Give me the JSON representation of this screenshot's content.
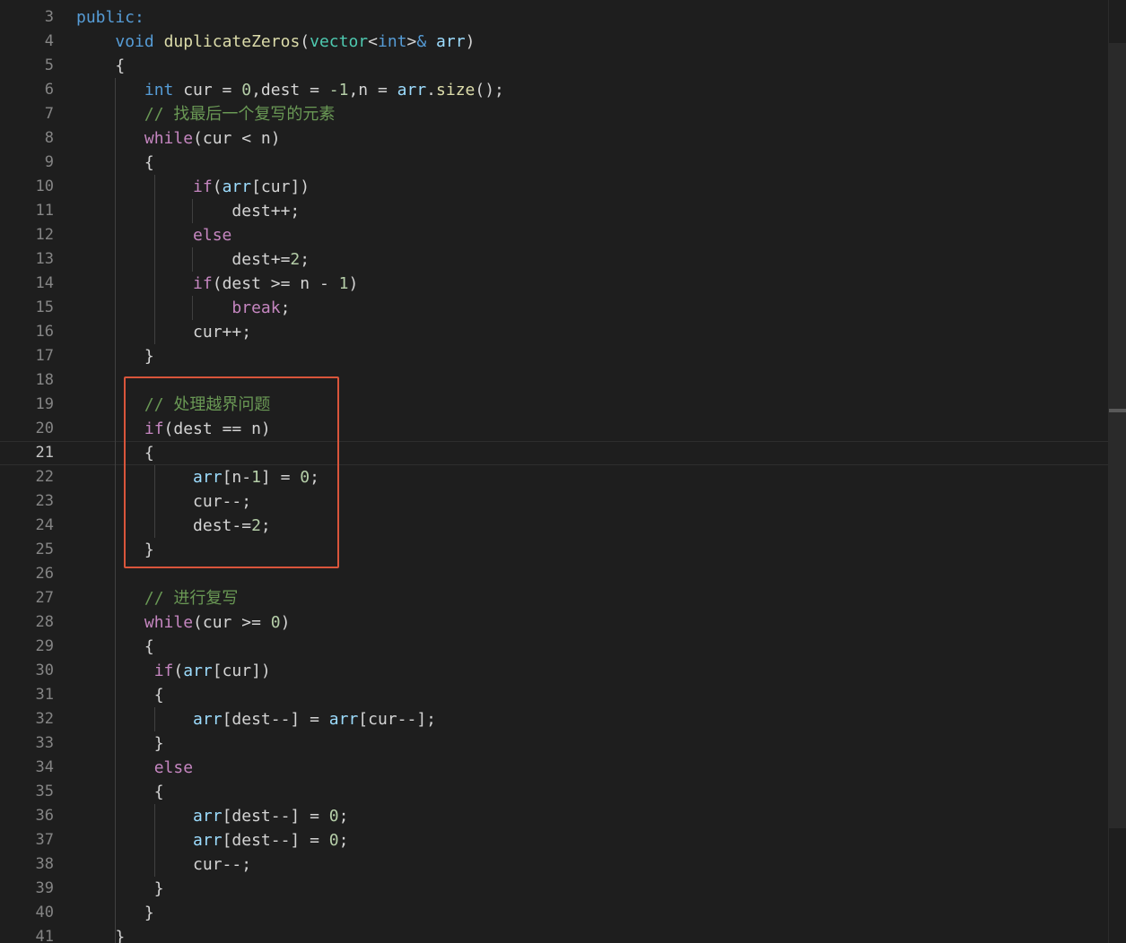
{
  "editor": {
    "active_line": 21,
    "theme": {
      "background": "#1e1e1e",
      "keyword_blue": "#569cd6",
      "control_purple": "#c586c0",
      "function_yellow": "#dcdcaa",
      "type_teal": "#4ec9b0",
      "variable": "#9cdcfe",
      "number": "#b5cea8",
      "comment": "#6a9955",
      "plain": "#d4d4d4",
      "highlight_box": "#d9553b"
    },
    "lines": [
      {
        "n": 3,
        "tokens": [
          [
            "k",
            "public:"
          ]
        ]
      },
      {
        "n": 4,
        "tokens": [
          [
            "p",
            "    "
          ],
          [
            "k",
            "void"
          ],
          [
            "p",
            " "
          ],
          [
            "f",
            "duplicateZeros"
          ],
          [
            "p",
            "("
          ],
          [
            "t",
            "vector"
          ],
          [
            "p",
            "<"
          ],
          [
            "k",
            "int"
          ],
          [
            "p",
            ">"
          ],
          [
            "k",
            "&"
          ],
          [
            "p",
            " "
          ],
          [
            "v",
            "arr"
          ],
          [
            "p",
            ")"
          ]
        ]
      },
      {
        "n": 5,
        "tokens": [
          [
            "p",
            "    {"
          ]
        ]
      },
      {
        "n": 6,
        "tokens": [
          [
            "p",
            "       "
          ],
          [
            "k",
            "int"
          ],
          [
            "p",
            " cur = "
          ],
          [
            "num",
            "0"
          ],
          [
            "p",
            ",dest = "
          ],
          [
            "num",
            "-1"
          ],
          [
            "p",
            ",n = "
          ],
          [
            "v",
            "arr"
          ],
          [
            "p",
            "."
          ],
          [
            "f",
            "size"
          ],
          [
            "p",
            "();"
          ]
        ]
      },
      {
        "n": 7,
        "tokens": [
          [
            "p",
            "       "
          ],
          [
            "c",
            "// 找最后一个复写的元素"
          ]
        ]
      },
      {
        "n": 8,
        "tokens": [
          [
            "p",
            "       "
          ],
          [
            "ctl",
            "while"
          ],
          [
            "p",
            "(cur < n)"
          ]
        ]
      },
      {
        "n": 9,
        "tokens": [
          [
            "p",
            "       {"
          ]
        ]
      },
      {
        "n": 10,
        "tokens": [
          [
            "p",
            "            "
          ],
          [
            "ctl",
            "if"
          ],
          [
            "p",
            "("
          ],
          [
            "v",
            "arr"
          ],
          [
            "p",
            "[cur])"
          ]
        ]
      },
      {
        "n": 11,
        "tokens": [
          [
            "p",
            "                dest++;"
          ]
        ]
      },
      {
        "n": 12,
        "tokens": [
          [
            "p",
            "            "
          ],
          [
            "ctl",
            "else"
          ]
        ]
      },
      {
        "n": 13,
        "tokens": [
          [
            "p",
            "                dest+="
          ],
          [
            "num",
            "2"
          ],
          [
            "p",
            ";"
          ]
        ]
      },
      {
        "n": 14,
        "tokens": [
          [
            "p",
            "            "
          ],
          [
            "ctl",
            "if"
          ],
          [
            "p",
            "(dest >= n - "
          ],
          [
            "num",
            "1"
          ],
          [
            "p",
            ")"
          ]
        ]
      },
      {
        "n": 15,
        "tokens": [
          [
            "p",
            "                "
          ],
          [
            "ctl",
            "break"
          ],
          [
            "p",
            ";"
          ]
        ]
      },
      {
        "n": 16,
        "tokens": [
          [
            "p",
            "            cur++;"
          ]
        ]
      },
      {
        "n": 17,
        "tokens": [
          [
            "p",
            "       }"
          ]
        ]
      },
      {
        "n": 18,
        "tokens": []
      },
      {
        "n": 19,
        "tokens": [
          [
            "p",
            "       "
          ],
          [
            "c",
            "// 处理越界问题"
          ]
        ]
      },
      {
        "n": 20,
        "tokens": [
          [
            "p",
            "       "
          ],
          [
            "ctl",
            "if"
          ],
          [
            "p",
            "(dest == n)"
          ]
        ]
      },
      {
        "n": 21,
        "tokens": [
          [
            "p",
            "       {"
          ]
        ]
      },
      {
        "n": 22,
        "tokens": [
          [
            "p",
            "            "
          ],
          [
            "v",
            "arr"
          ],
          [
            "p",
            "[n-"
          ],
          [
            "num",
            "1"
          ],
          [
            "p",
            "] = "
          ],
          [
            "num",
            "0"
          ],
          [
            "p",
            ";"
          ]
        ]
      },
      {
        "n": 23,
        "tokens": [
          [
            "p",
            "            cur--;"
          ]
        ]
      },
      {
        "n": 24,
        "tokens": [
          [
            "p",
            "            dest-="
          ],
          [
            "num",
            "2"
          ],
          [
            "p",
            ";"
          ]
        ]
      },
      {
        "n": 25,
        "tokens": [
          [
            "p",
            "       }"
          ]
        ]
      },
      {
        "n": 26,
        "tokens": []
      },
      {
        "n": 27,
        "tokens": [
          [
            "p",
            "       "
          ],
          [
            "c",
            "// 进行复写"
          ]
        ]
      },
      {
        "n": 28,
        "tokens": [
          [
            "p",
            "       "
          ],
          [
            "ctl",
            "while"
          ],
          [
            "p",
            "(cur >= "
          ],
          [
            "num",
            "0"
          ],
          [
            "p",
            ")"
          ]
        ]
      },
      {
        "n": 29,
        "tokens": [
          [
            "p",
            "       {"
          ]
        ]
      },
      {
        "n": 30,
        "tokens": [
          [
            "p",
            "        "
          ],
          [
            "ctl",
            "if"
          ],
          [
            "p",
            "("
          ],
          [
            "v",
            "arr"
          ],
          [
            "p",
            "[cur])"
          ]
        ]
      },
      {
        "n": 31,
        "tokens": [
          [
            "p",
            "        {"
          ]
        ]
      },
      {
        "n": 32,
        "tokens": [
          [
            "p",
            "            "
          ],
          [
            "v",
            "arr"
          ],
          [
            "p",
            "[dest--] = "
          ],
          [
            "v",
            "arr"
          ],
          [
            "p",
            "[cur--];"
          ]
        ]
      },
      {
        "n": 33,
        "tokens": [
          [
            "p",
            "        }"
          ]
        ]
      },
      {
        "n": 34,
        "tokens": [
          [
            "p",
            "        "
          ],
          [
            "ctl",
            "else"
          ]
        ]
      },
      {
        "n": 35,
        "tokens": [
          [
            "p",
            "        {"
          ]
        ]
      },
      {
        "n": 36,
        "tokens": [
          [
            "p",
            "            "
          ],
          [
            "v",
            "arr"
          ],
          [
            "p",
            "[dest--] = "
          ],
          [
            "num",
            "0"
          ],
          [
            "p",
            ";"
          ]
        ]
      },
      {
        "n": 37,
        "tokens": [
          [
            "p",
            "            "
          ],
          [
            "v",
            "arr"
          ],
          [
            "p",
            "[dest--] = "
          ],
          [
            "num",
            "0"
          ],
          [
            "p",
            ";"
          ]
        ]
      },
      {
        "n": 38,
        "tokens": [
          [
            "p",
            "            cur--;"
          ]
        ]
      },
      {
        "n": 39,
        "tokens": [
          [
            "p",
            "        }"
          ]
        ]
      },
      {
        "n": 40,
        "tokens": [
          [
            "p",
            "       }"
          ]
        ]
      },
      {
        "n": 41,
        "tokens": [
          [
            "p",
            "    }"
          ]
        ]
      }
    ]
  }
}
